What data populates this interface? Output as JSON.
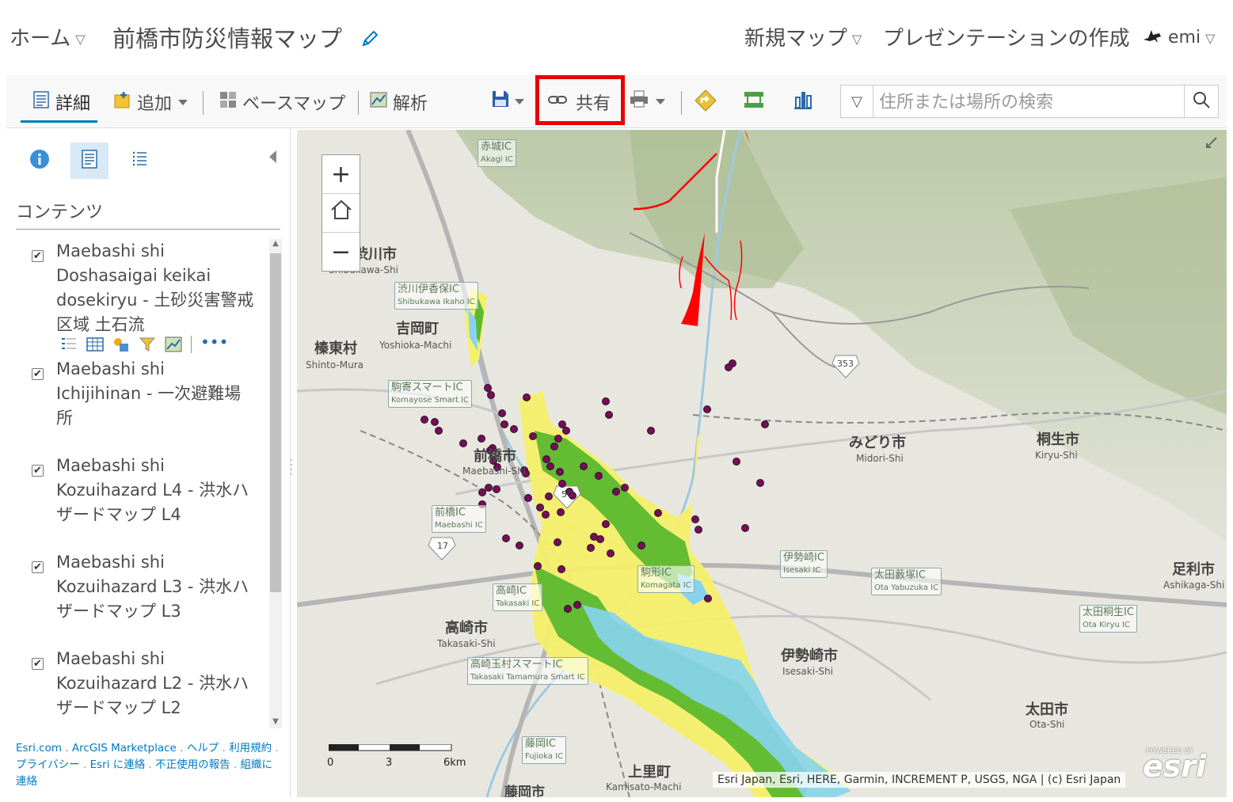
{
  "header": {
    "home_label": "ホーム",
    "map_title": "前橋市防災情報マップ",
    "new_map_label": "新規マップ",
    "presentation_label": "プレゼンテーションの作成",
    "user_name": "emi"
  },
  "toolbar": {
    "details_label": "詳細",
    "add_label": "追加",
    "basemap_label": "ベースマップ",
    "analysis_label": "解析",
    "share_label": "共有",
    "search_placeholder": "住所または場所の検索"
  },
  "panel": {
    "title": "コンテンツ",
    "layers": [
      {
        "name": "Maebashi shi Doshasaigai keikai dosekiryu - 土砂災害警戒区域 土石流",
        "checked": true
      },
      {
        "name": "Maebashi shi Ichijihinan - 一次避難場所",
        "checked": true
      },
      {
        "name": "Maebashi shi Kozuihazard L4 - 洪水ハザードマップ L4",
        "checked": true
      },
      {
        "name": "Maebashi shi Kozuihazard L3 - 洪水ハザードマップ L3",
        "checked": true
      },
      {
        "name": "Maebashi shi Kozuihazard L2 - 洪水ハザードマップ L2",
        "checked": true
      }
    ],
    "footer_links": [
      "Esri.com",
      "ArcGIS Marketplace",
      "ヘルプ",
      "利用規約",
      "プライバシー",
      "Esri に連絡",
      "不正使用の報告",
      "組織に連絡"
    ]
  },
  "map": {
    "attribution": "Esri Japan, Esri, HERE, Garmin, INCREMENT P, USGS, NGA | (c) Esri Japan",
    "scale_labels": [
      "0",
      "3",
      "6km"
    ],
    "esri_powered": "POWERED BY",
    "esri_logo": "esri",
    "place_labels": [
      {
        "ja": "赤城IC",
        "en": "Akagi IC"
      },
      {
        "ja": "渋川市",
        "en": "Shibukawa-Shi"
      },
      {
        "ja": "渋川伊香保IC",
        "en": "Shibukawa Ikaho IC"
      },
      {
        "ja": "吉岡町",
        "en": "Yoshioka-Machi"
      },
      {
        "ja": "榛東村",
        "en": "Shinto-Mura"
      },
      {
        "ja": "駒寄スマートIC",
        "en": "Komayose Smart IC"
      },
      {
        "ja": "前橋市",
        "en": "Maebashi-Shi"
      },
      {
        "ja": "前橋IC",
        "en": "Maebashi IC"
      },
      {
        "ja": "みどり市",
        "en": "Midori-Shi"
      },
      {
        "ja": "桐生市",
        "en": "Kiryu-Shi"
      },
      {
        "ja": "伊勢崎IC",
        "en": "Isesaki IC"
      },
      {
        "ja": "太田藪塚IC",
        "en": "Ota Yabuzuka IC"
      },
      {
        "ja": "足利市",
        "en": "Ashikaga-Shi"
      },
      {
        "ja": "太田桐生IC",
        "en": "Ota Kiryu IC"
      },
      {
        "ja": "高崎市",
        "en": "Takasaki-Shi"
      },
      {
        "ja": "高崎IC",
        "en": "Takasaki IC"
      },
      {
        "ja": "高崎玉村スマートIC",
        "en": "Takasaki Tamamura Smart IC"
      },
      {
        "ja": "伊勢崎市",
        "en": "Isesaki-Shi"
      },
      {
        "ja": "太田市",
        "en": "Ota-Shi"
      },
      {
        "ja": "藤岡IC",
        "en": "Fujioka IC"
      },
      {
        "ja": "上里町",
        "en": "Kamisato-Machi"
      },
      {
        "ja": "藤岡市",
        "en": ""
      },
      {
        "ja": "駒形IC",
        "en": "Komagata IC"
      }
    ],
    "route_shields": [
      "353",
      "50",
      "17"
    ]
  },
  "colors": {
    "accent": "#0079c1",
    "highlight": "#e60000",
    "shelter_point": "#7a0a5a",
    "flood_l4": "#f5ef6a",
    "flood_l3": "#5cb82e",
    "flood_l2": "#86d3f0",
    "debris_flow": "#ff0000"
  }
}
